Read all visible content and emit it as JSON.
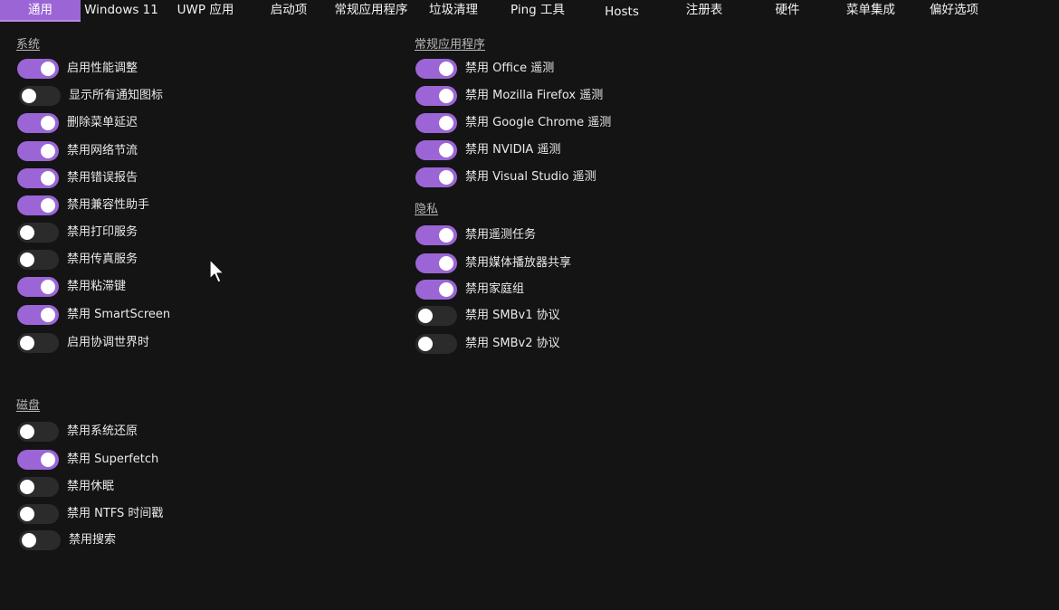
{
  "tabs": [
    {
      "label": "通用",
      "active": true
    },
    {
      "label": "Windows 11",
      "active": false
    },
    {
      "label": "UWP 应用",
      "active": false
    },
    {
      "label": "启动项",
      "active": false
    },
    {
      "label": "常规应用程序",
      "active": false
    },
    {
      "label": "垃圾清理",
      "active": false
    },
    {
      "label": "Ping 工具",
      "active": false
    },
    {
      "label": "Hosts",
      "active": false
    },
    {
      "label": "注册表",
      "active": false
    },
    {
      "label": "硬件",
      "active": false
    },
    {
      "label": "菜单集成",
      "active": false
    },
    {
      "label": "偏好选项",
      "active": false
    }
  ],
  "system": {
    "title": "系统",
    "items": [
      {
        "label": "启用性能调整",
        "checked": true
      },
      {
        "label": "显示所有通知图标",
        "checked": false
      },
      {
        "label": "删除菜单延迟",
        "checked": true
      },
      {
        "label": "禁用网络节流",
        "checked": true
      },
      {
        "label": "禁用错误报告",
        "checked": true
      },
      {
        "label": "禁用兼容性助手",
        "checked": true
      },
      {
        "label": "禁用打印服务",
        "checked": false
      },
      {
        "label": "禁用传真服务",
        "checked": false
      },
      {
        "label": "禁用粘滞键",
        "checked": true
      },
      {
        "label": "禁用 SmartScreen",
        "checked": true
      },
      {
        "label": "启用协调世界时",
        "checked": false
      }
    ]
  },
  "disk": {
    "title": "磁盘",
    "items": [
      {
        "label": "禁用系统还原",
        "checked": false
      },
      {
        "label": "禁用 Superfetch",
        "checked": true
      },
      {
        "label": "禁用休眠",
        "checked": false
      },
      {
        "label": "禁用 NTFS 时间戳",
        "checked": false
      },
      {
        "label": "禁用搜索",
        "checked": false
      }
    ]
  },
  "apps": {
    "title": "常规应用程序",
    "items": [
      {
        "label": "禁用 Office 遥测",
        "checked": true
      },
      {
        "label": "禁用 Mozilla Firefox 遥测",
        "checked": true
      },
      {
        "label": "禁用 Google Chrome 遥测",
        "checked": true
      },
      {
        "label": "禁用 NVIDIA 遥测",
        "checked": true
      },
      {
        "label": "禁用 Visual Studio 遥测",
        "checked": true
      }
    ]
  },
  "privacy": {
    "title": "隐私",
    "items": [
      {
        "label": "禁用遥测任务",
        "checked": true
      },
      {
        "label": "禁用媒体播放器共享",
        "checked": true
      },
      {
        "label": "禁用家庭组",
        "checked": true
      },
      {
        "label": "禁用 SMBv1 协议",
        "checked": false
      },
      {
        "label": "禁用 SMBv2 协议",
        "checked": false
      }
    ]
  },
  "colors": {
    "accent": "#9b65d6",
    "background": "#141414",
    "toggle_off": "#2b2b2b"
  }
}
